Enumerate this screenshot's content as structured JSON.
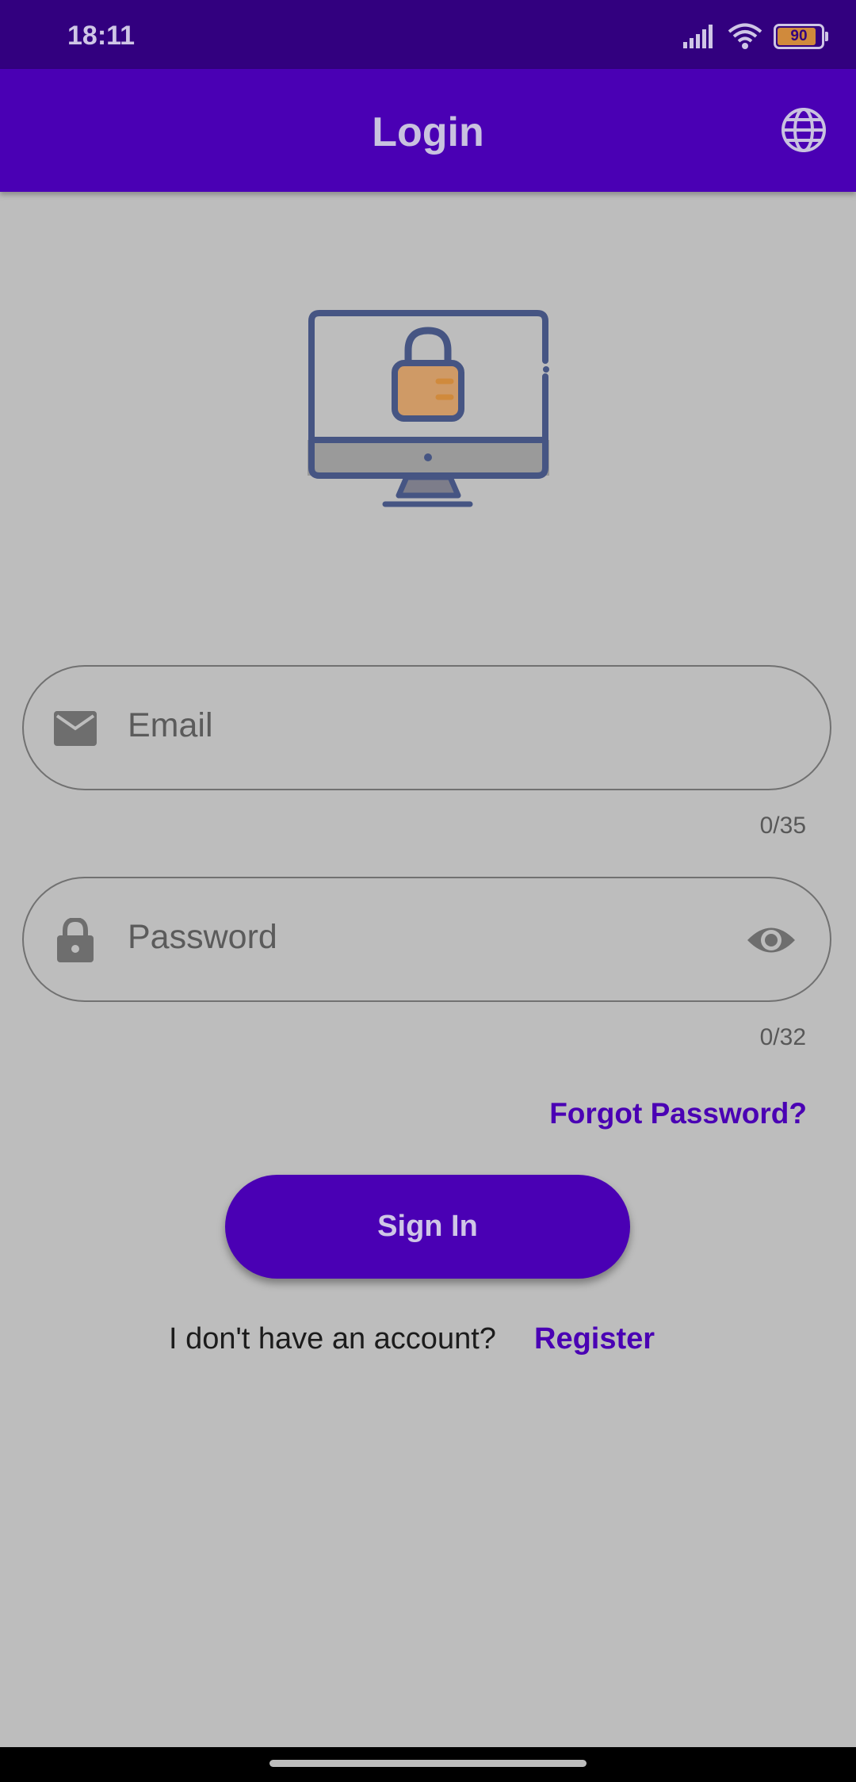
{
  "status_bar": {
    "time": "18:11",
    "battery_level": "90"
  },
  "app_bar": {
    "title": "Login",
    "language_icon": "globe-icon"
  },
  "hero": {
    "icon": "monitor-lock-illustration"
  },
  "email": {
    "placeholder": "Email",
    "value": "",
    "counter": "0/35",
    "icon": "mail-icon"
  },
  "password": {
    "placeholder": "Password",
    "value": "",
    "counter": "0/32",
    "icon": "lock-icon",
    "toggle_icon": "eye-icon"
  },
  "links": {
    "forgot_password": "Forgot Password?"
  },
  "actions": {
    "sign_in": "Sign In"
  },
  "register": {
    "prompt": "I don't have an account?",
    "link": "Register"
  },
  "colors": {
    "primary": "#4a00b4",
    "status_bar": "#32007f",
    "background": "#bdbdbd"
  }
}
